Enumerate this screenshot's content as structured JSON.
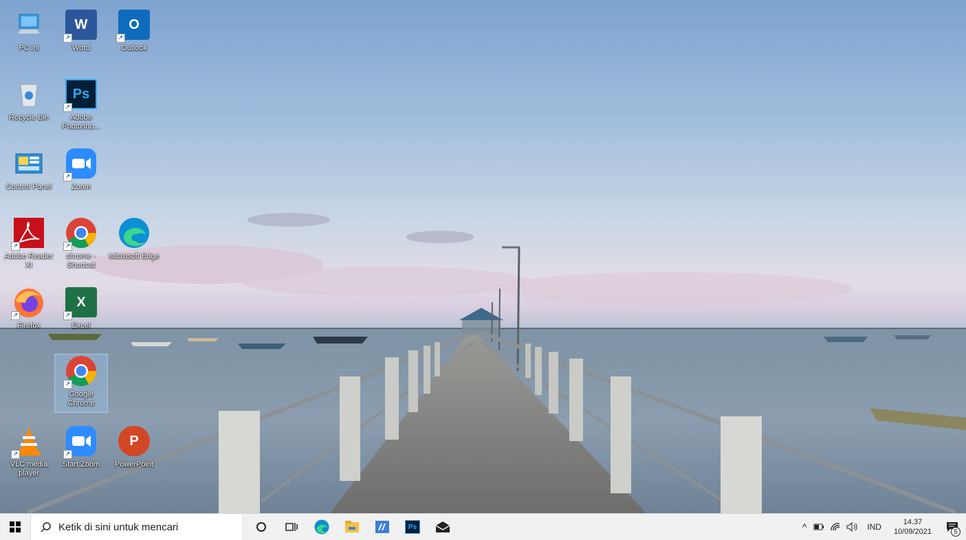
{
  "desktop_icons": [
    {
      "label": "PC ini",
      "icon": "monitor-icon"
    },
    {
      "label": "Word",
      "icon": "word-icon"
    },
    {
      "label": "Outlook",
      "icon": "outlook-icon"
    },
    {
      "label": "Recycle Bin",
      "icon": "recycle-bin-icon"
    },
    {
      "label": "Adobe Photosho...",
      "icon": "photoshop-icon"
    },
    {
      "label": "Control Panel",
      "icon": "control-panel-icon"
    },
    {
      "label": "Zoom",
      "icon": "zoom-icon"
    },
    {
      "label": "Adobe Reader XI",
      "icon": "adobe-reader-icon"
    },
    {
      "label": "chrome - Shortcut",
      "icon": "chrome-icon"
    },
    {
      "label": "Microsoft Edge",
      "icon": "edge-icon"
    },
    {
      "label": "Firefox",
      "icon": "firefox-icon"
    },
    {
      "label": "Excel",
      "icon": "excel-icon"
    },
    {
      "label": "Google Chrome",
      "icon": "chrome-icon"
    },
    {
      "label": "VLC media player",
      "icon": "vlc-icon"
    },
    {
      "label": "Start Zoom",
      "icon": "zoom-icon"
    },
    {
      "label": "PowerPoint",
      "icon": "powerpoint-icon"
    }
  ],
  "icon_glyphs": {
    "word": "W",
    "outlook": "O",
    "photoshop": "Ps",
    "excel": "X",
    "powerpoint": "P",
    "shortcut": "↗"
  },
  "taskbar": {
    "search_placeholder": "Ketik di sini untuk mencari",
    "pinned_apps": [
      "cortana-icon",
      "task-view-icon",
      "edge-icon",
      "file-explorer-icon",
      "app-icon",
      "photoshop-icon",
      "mail-icon"
    ],
    "language": "IND",
    "time": "14.37",
    "date": "10/09/2021",
    "notification_count": "5"
  },
  "colors": {
    "taskbar_bg": "#f1f1f1",
    "word": "#2b579a",
    "outlook": "#0f6cbd",
    "excel": "#1e7145",
    "powerpoint": "#d24726",
    "photoshop": "#001e36",
    "zoom": "#2d8cff"
  }
}
